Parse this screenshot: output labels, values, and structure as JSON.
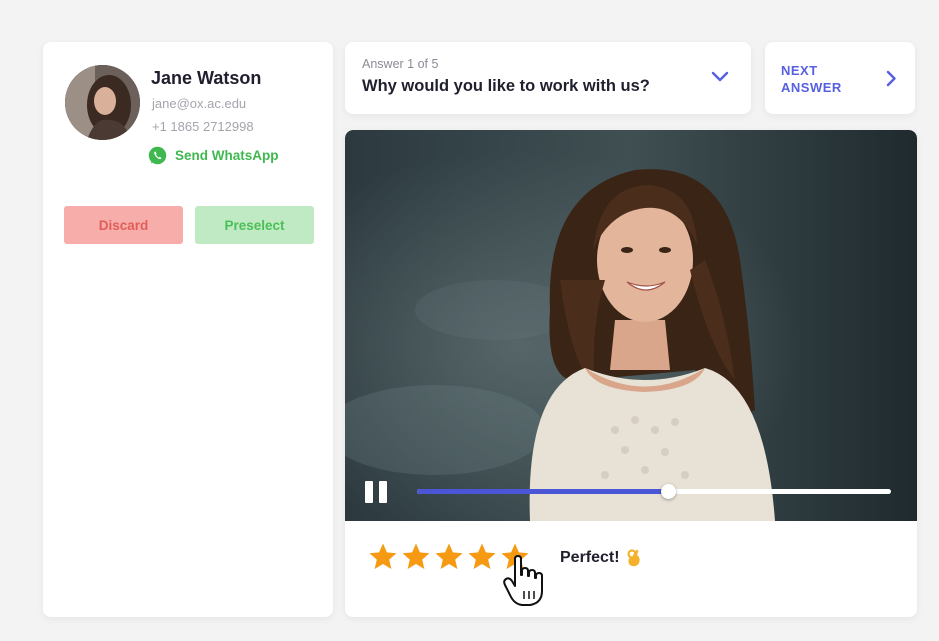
{
  "candidate": {
    "name": "Jane Watson",
    "email": "jane@ox.ac.edu",
    "phone": "+1 1865 2712998",
    "whatsapp_label": "Send WhatsApp",
    "discard_label": "Discard",
    "preselect_label": "Preselect"
  },
  "question": {
    "counter": "Answer 1 of 5",
    "text": "Why would you like to work with us?"
  },
  "next": {
    "line1": "NEXT",
    "line2": "ANSWER"
  },
  "player": {
    "progress_fraction": 0.53
  },
  "rating": {
    "stars": 5,
    "max": 5,
    "label": "Perfect!"
  },
  "colors": {
    "accent": "#4a56d6",
    "whatsapp": "#3fb94f",
    "star": "#f59a12",
    "discard_bg": "#f7aeab",
    "preselect_bg": "#bfeac3"
  },
  "icons": {
    "whatsapp": "whatsapp-icon",
    "dropdown": "chevron-down-icon",
    "next": "chevron-right-icon",
    "pause": "pause-icon",
    "star": "star-icon",
    "ok_hand": "ok-hand-icon",
    "cursor": "hand-cursor-icon"
  }
}
